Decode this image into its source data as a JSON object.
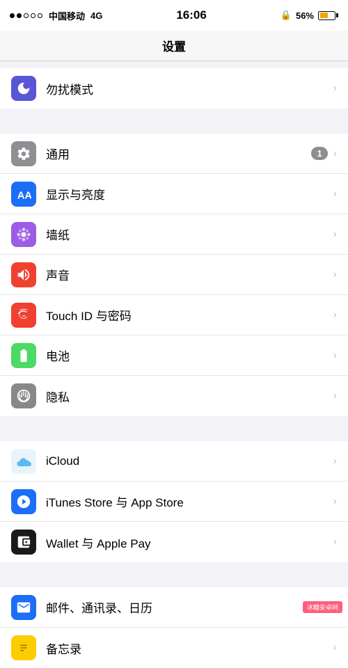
{
  "statusBar": {
    "carrier": "中国移动",
    "network": "4G",
    "time": "16:06",
    "batteryPercent": "56%",
    "lockIcon": "🔒"
  },
  "header": {
    "title": "设置"
  },
  "sections": [
    {
      "id": "section-do-not-disturb",
      "items": [
        {
          "id": "do-not-disturb",
          "icon": "moon",
          "iconBg": "#5856d6",
          "label": "勿扰模式",
          "badge": null,
          "chevron": "›"
        }
      ]
    },
    {
      "id": "section-display",
      "items": [
        {
          "id": "general",
          "icon": "gear",
          "iconBg": "#8e8e93",
          "label": "通用",
          "badge": "1",
          "chevron": "›"
        },
        {
          "id": "display",
          "icon": "AA",
          "iconBg": "#1c6ef7",
          "label": "显示与亮度",
          "badge": null,
          "chevron": "›"
        },
        {
          "id": "wallpaper",
          "icon": "flower",
          "iconBg": "#9b5de5",
          "label": "墙纸",
          "badge": null,
          "chevron": "›"
        },
        {
          "id": "sounds",
          "icon": "speaker",
          "iconBg": "#f04030",
          "label": "声音",
          "badge": null,
          "chevron": "›"
        },
        {
          "id": "touchid",
          "icon": "fingerprint",
          "iconBg": "#f04030",
          "label": "Touch ID 与密码",
          "badge": null,
          "chevron": "›"
        },
        {
          "id": "battery",
          "icon": "battery",
          "iconBg": "#4cd964",
          "label": "电池",
          "badge": null,
          "chevron": "›"
        },
        {
          "id": "privacy",
          "icon": "hand",
          "iconBg": "#888888",
          "label": "隐私",
          "badge": null,
          "chevron": "›"
        }
      ]
    },
    {
      "id": "section-accounts",
      "items": [
        {
          "id": "icloud",
          "icon": "cloud",
          "iconBg": "transparent",
          "label": "iCloud",
          "badge": null,
          "chevron": "›"
        },
        {
          "id": "itunes",
          "icon": "itunes",
          "iconBg": "#1c6ef7",
          "label": "iTunes Store 与 App Store",
          "badge": null,
          "chevron": "›"
        },
        {
          "id": "wallet",
          "icon": "wallet",
          "iconBg": "#1a1a1a",
          "label": "Wallet 与 Apple Pay",
          "badge": null,
          "chevron": "›"
        }
      ]
    },
    {
      "id": "section-apps",
      "items": [
        {
          "id": "mail",
          "icon": "mail",
          "iconBg": "#1c6ef7",
          "label": "邮件、通讯录、日历",
          "badge": null,
          "chevron": "›"
        },
        {
          "id": "notes",
          "icon": "notes",
          "iconBg": "#fecc02",
          "label": "备忘录",
          "badge": null,
          "chevron": "›"
        }
      ]
    }
  ],
  "watermark": "冰糖安卓网"
}
